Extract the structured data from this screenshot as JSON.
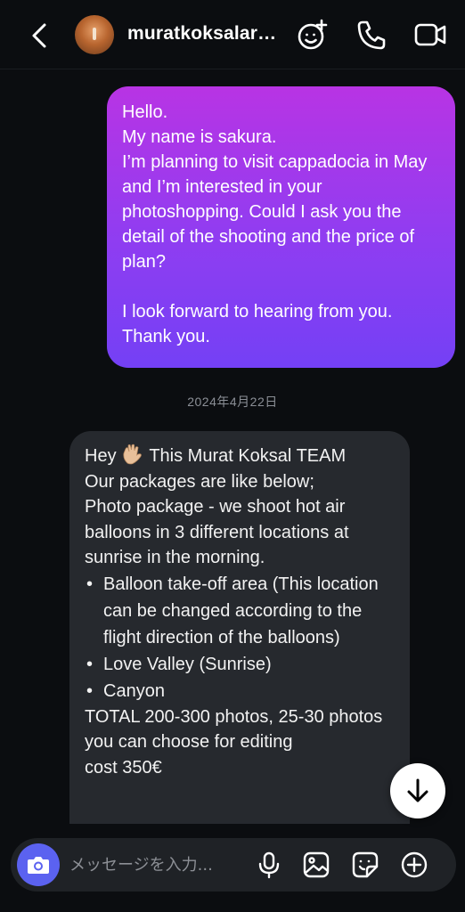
{
  "header": {
    "username": "muratkoksalar…",
    "back_icon": "chevron-left-icon",
    "icons": [
      "effects-icon",
      "phone-icon",
      "video-icon"
    ]
  },
  "messages": {
    "outgoing": {
      "lines": [
        "Hello.",
        "My name is sakura.",
        "I’m planning to visit cappadocia in May and I’m interested in your photoshopping. Could I ask you the detail of the shooting and the price of plan?",
        "I look forward to hearing from you. Thank you."
      ]
    },
    "date_separator": "2024年4月22日",
    "incoming": {
      "greeting_before": "Hey ",
      "greeting_emoji": "waving-hand-icon",
      "greeting_after": " This Murat Koksal TEAM",
      "line2": "Our packages are like below;",
      "line3": "Photo package - we shoot hot air balloons in 3 different locations at sunrise in the morning.",
      "bullets": [
        "Balloon take-off area (This location can be changed according to the flight direction of the balloons)",
        "Love Valley (Sunrise)",
        "Canyon"
      ],
      "line_total": "TOTAL 200-300 photos, 25-30 photos you can choose for editing",
      "line_cost": "cost 350€"
    }
  },
  "composer": {
    "placeholder": "メッセージを入力...",
    "icons": [
      "camera-icon",
      "microphone-icon",
      "gallery-icon",
      "sticker-icon",
      "plus-circle-icon"
    ]
  },
  "colors": {
    "background": "#0b0d10",
    "outgoing_gradient_top": "#b834e4",
    "outgoing_gradient_bottom": "#7440f5",
    "incoming_bubble": "#26292e",
    "camera_button": "#5b62f0"
  }
}
